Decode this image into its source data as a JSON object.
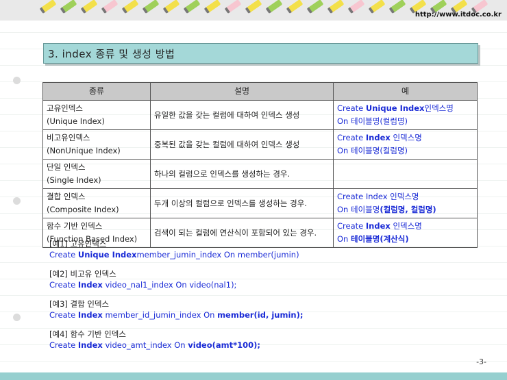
{
  "header": {
    "url": "http://www.itdoc.co.kr"
  },
  "title": "3. index 종류 및 생성 방법",
  "table": {
    "headers": [
      "종류",
      "설명",
      "예"
    ],
    "rows": [
      {
        "type_ko": "고유인덱스",
        "type_en": "(Unique Index)",
        "desc": "유일한 값을 갖는 컬럼에 대하여 인덱스 생성",
        "ex1_a": "Create ",
        "ex1_b": "Unique Index",
        "ex1_c": "인덱스명",
        "ex2_a": "On 테이블명(컬럼명)",
        "ex2_b": ""
      },
      {
        "type_ko": "비고유인덱스",
        "type_en": "(NonUnique Index)",
        "desc": "중복된 값을 갖는 컬럼에 대하여 인덱스 생성",
        "ex1_a": "Create ",
        "ex1_b": "Index",
        "ex1_c": " 인덱스명",
        "ex2_a": "On 테이블명(컬럼명)",
        "ex2_b": ""
      },
      {
        "type_ko": "단일 인덱스",
        "type_en": "(Single Index)",
        "desc": "하나의 컬럼으로 인덱스를 생성하는 경우.",
        "ex1_a": "",
        "ex1_b": "",
        "ex1_c": "",
        "ex2_a": "",
        "ex2_b": ""
      },
      {
        "type_ko": "결합 인덱스",
        "type_en": "(Composite Index)",
        "desc": "두개 이상의 컬럼으로 인덱스를 생성하는 경우.",
        "ex1_a": "Create Index 인덱스명",
        "ex1_b": "",
        "ex1_c": "",
        "ex2_a": "On 테이블명",
        "ex2_b": "(컬럼명, 컬럼명)"
      },
      {
        "type_ko": "함수 기반 인덱스",
        "type_en": "(Function Based Index)",
        "desc": "검색이 되는 컬럼에 연산식이 포함되어 있는 경우.",
        "ex1_a": "Create ",
        "ex1_b": "Index",
        "ex1_c": " 인덱스명",
        "ex2_a": "On ",
        "ex2_b": "테이블명(계산식)"
      }
    ]
  },
  "examples": [
    {
      "heading": "[예1] 고유인덱스",
      "code_a": "Create ",
      "code_b": "Unique Index",
      "code_c": "member_jumin_index  On member(jumin)",
      "code_d": ""
    },
    {
      "heading": "[예2] 비고유 인덱스",
      "code_a": "Create ",
      "code_b": "Index",
      "code_c": " video_nal1_index  On video(nal1);",
      "code_d": ""
    },
    {
      "heading": "[예3] 결합 인덱스",
      "code_a": "Create ",
      "code_b": "Index",
      "code_c": " member_id_jumin_index  On ",
      "code_d": "member(id, jumin);"
    },
    {
      "heading": "[예4] 함수 기반 인덱스",
      "code_a": "Create ",
      "code_b": "Index",
      "code_c": " video_amt_index On ",
      "code_d": "video(amt*100);"
    }
  ],
  "page_number": "-3-",
  "colors": {
    "title_bg": "#a4d8d8",
    "code_blue": "#1a2bd6",
    "footer_bar": "#96cfcf"
  }
}
